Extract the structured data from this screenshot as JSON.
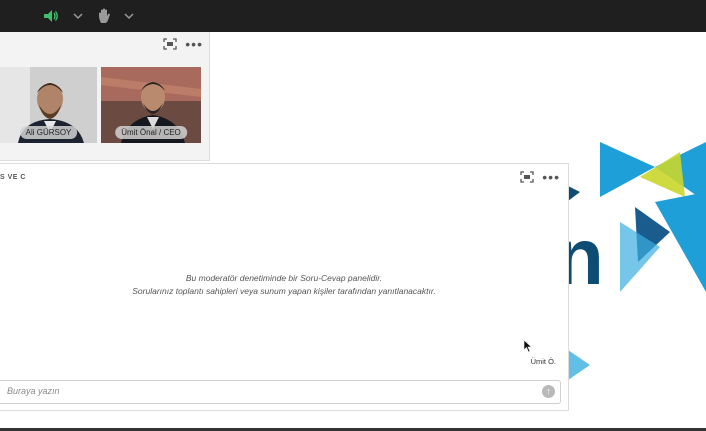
{
  "topbar": {
    "icons": [
      "speaker-icon",
      "chevron-down-icon",
      "raise-hand-icon",
      "chevron-down-icon"
    ],
    "colors": {
      "background": "#1f1f1f",
      "speaker": "#3fbf6a",
      "hand": "#9a9a9a"
    }
  },
  "video_pod": {
    "participants": [
      {
        "name": "Ali GÜRSOY"
      },
      {
        "name": "Ümit Önal / CEO"
      }
    ]
  },
  "qa_pod": {
    "title": "S VE C",
    "message_line1": "Bu moderatör denetiminde bir Soru-Cevap panelidir.",
    "message_line2": "Sorularınız toplantı sahipleri veya sunum yapan kişiler tarafından yanıtlanacaktır.",
    "user_label": "Ümit Ö.",
    "input_placeholder": "Buraya yazın",
    "send_glyph": "↑"
  },
  "slide": {
    "brand_letter": "n",
    "colors": {
      "blue": "#1f9fd8",
      "dark_blue": "#1a5c8e",
      "green": "#c9d62b",
      "text": "#0d4d73"
    }
  }
}
